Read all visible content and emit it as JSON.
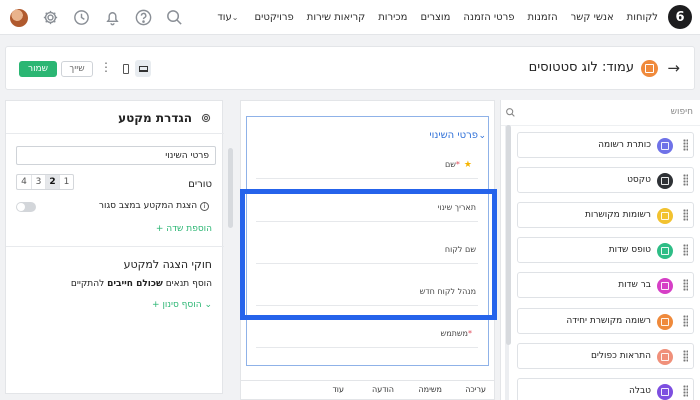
{
  "topnav": {
    "logo": "6",
    "items": [
      "לקוחות",
      "אנשי קשר",
      "הזמנות",
      "פרטי הזמנה",
      "מוצרים",
      "מכירות",
      "קריאות שירות",
      "פרויקטים",
      "עוד"
    ],
    "icons": [
      "search-icon",
      "help-icon",
      "bell-icon",
      "history-icon",
      "gear-icon",
      "avatar"
    ]
  },
  "header": {
    "title": "עמוד: לוג סטטוסים",
    "save_label": "שמור",
    "assign_label": "שייך",
    "more_label": "⋮"
  },
  "components": {
    "search_placeholder": "חיפוש",
    "items": [
      {
        "label": "כותרת רשומה",
        "color": "#6f72e8"
      },
      {
        "label": "טקסט",
        "color": "#2f3236"
      },
      {
        "label": "רשומות מקושרות",
        "color": "#f2c230"
      },
      {
        "label": "טופס שדות",
        "color": "#2ebd86"
      },
      {
        "label": "בר שדות",
        "color": "#d63fc6"
      },
      {
        "label": "רשומה מקושרת יחידה",
        "color": "#ef8a3c"
      },
      {
        "label": "התראות כפולים",
        "color": "#f0907a"
      },
      {
        "label": "טבלה",
        "color": "#7d4fe0"
      }
    ]
  },
  "canvas": {
    "section_title": "פרטי השינוי",
    "fields": [
      {
        "label": "שם",
        "required": true,
        "starred": true
      },
      {
        "label": "תאריך שינוי",
        "required": false,
        "starred": false
      },
      {
        "label": "שם לקוח",
        "required": false,
        "starred": false
      },
      {
        "label": "מנהל לקוח חדש",
        "required": false,
        "starred": false
      },
      {
        "label": "משתמש",
        "required": true,
        "starred": false
      }
    ],
    "required_mark": "*",
    "star_mark": "★",
    "bottom_items": [
      "עריכה",
      "משימה",
      "הודעה",
      "עוד"
    ]
  },
  "settings": {
    "title": "הגדרת מקטע",
    "section_name": "פרטי השינוי",
    "columns_label": "טורים",
    "columns_options": [
      "1",
      "2",
      "3",
      "4"
    ],
    "columns_selected": "2",
    "closed_label": "הצגת המקטע במצב סגור",
    "closed_state": false,
    "add_field_label": "הוספת שדה",
    "rules_title": "חוקי הצגה למקטע",
    "rules_text_pre": "הוסף תנאים ",
    "rules_text_bold": "שכולם חייבים",
    "rules_text_post": " להתקיים",
    "add_filter_label": "הוסף סינון"
  }
}
